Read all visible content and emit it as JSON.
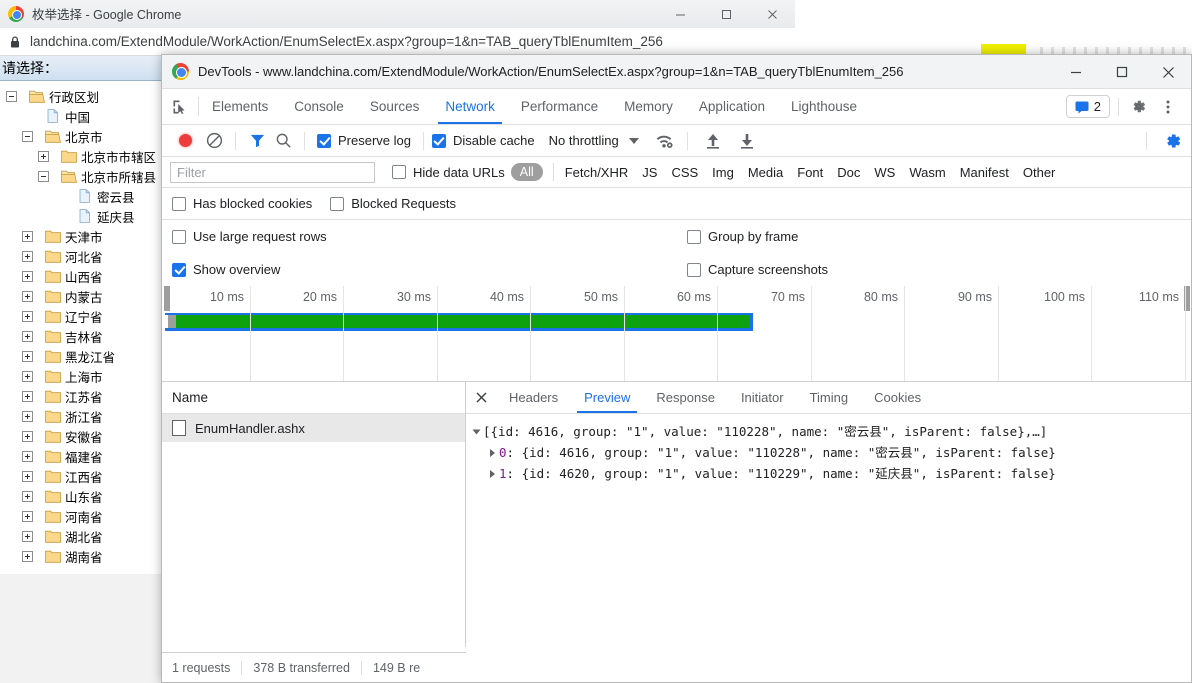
{
  "browser": {
    "window_title": "枚举选择 - Google Chrome",
    "url": "landchina.com/ExtendModule/WorkAction/EnumSelectEx.aspx?group=1&n=TAB_queryTblEnumItem_256",
    "lock_icon": "lock-icon",
    "minimize_label": "Minimize",
    "maximize_label": "Maximize",
    "close_label": "Close"
  },
  "page": {
    "prompt_label": "请选择：",
    "tree": [
      {
        "label": "行政区划",
        "depth": 0,
        "toggle": "minus",
        "icon": "folder-open"
      },
      {
        "label": "中国",
        "depth": 1,
        "toggle": "none",
        "icon": "file"
      },
      {
        "label": "北京市",
        "depth": 1,
        "toggle": "minus",
        "icon": "folder-open"
      },
      {
        "label": "北京市市辖区",
        "depth": 2,
        "toggle": "plus",
        "icon": "folder"
      },
      {
        "label": "北京市所辖县",
        "depth": 2,
        "toggle": "minus",
        "icon": "folder-open"
      },
      {
        "label": "密云县",
        "depth": 3,
        "toggle": "none",
        "icon": "file"
      },
      {
        "label": "延庆县",
        "depth": 3,
        "toggle": "none",
        "icon": "file"
      },
      {
        "label": "天津市",
        "depth": 1,
        "toggle": "plus",
        "icon": "folder"
      },
      {
        "label": "河北省",
        "depth": 1,
        "toggle": "plus",
        "icon": "folder"
      },
      {
        "label": "山西省",
        "depth": 1,
        "toggle": "plus",
        "icon": "folder"
      },
      {
        "label": "内蒙古",
        "depth": 1,
        "toggle": "plus",
        "icon": "folder"
      },
      {
        "label": "辽宁省",
        "depth": 1,
        "toggle": "plus",
        "icon": "folder"
      },
      {
        "label": "吉林省",
        "depth": 1,
        "toggle": "plus",
        "icon": "folder"
      },
      {
        "label": "黑龙江省",
        "depth": 1,
        "toggle": "plus",
        "icon": "folder"
      },
      {
        "label": "上海市",
        "depth": 1,
        "toggle": "plus",
        "icon": "folder"
      },
      {
        "label": "江苏省",
        "depth": 1,
        "toggle": "plus",
        "icon": "folder"
      },
      {
        "label": "浙江省",
        "depth": 1,
        "toggle": "plus",
        "icon": "folder"
      },
      {
        "label": "安徽省",
        "depth": 1,
        "toggle": "plus",
        "icon": "folder"
      },
      {
        "label": "福建省",
        "depth": 1,
        "toggle": "plus",
        "icon": "folder"
      },
      {
        "label": "江西省",
        "depth": 1,
        "toggle": "plus",
        "icon": "folder"
      },
      {
        "label": "山东省",
        "depth": 1,
        "toggle": "plus",
        "icon": "folder"
      },
      {
        "label": "河南省",
        "depth": 1,
        "toggle": "plus",
        "icon": "folder"
      },
      {
        "label": "湖北省",
        "depth": 1,
        "toggle": "plus",
        "icon": "folder"
      },
      {
        "label": "湖南省",
        "depth": 1,
        "toggle": "plus",
        "icon": "folder"
      }
    ]
  },
  "devtools": {
    "window_title": "DevTools - www.landchina.com/ExtendModule/WorkAction/EnumSelectEx.aspx?group=1&n=TAB_queryTblEnumItem_256",
    "inspect_icon": "inspect-element-icon",
    "tabs": [
      {
        "label": "Elements",
        "active": false
      },
      {
        "label": "Console",
        "active": false
      },
      {
        "label": "Sources",
        "active": false
      },
      {
        "label": "Network",
        "active": true
      },
      {
        "label": "Performance",
        "active": false
      },
      {
        "label": "Memory",
        "active": false
      },
      {
        "label": "Application",
        "active": false
      },
      {
        "label": "Lighthouse",
        "active": false
      }
    ],
    "message_count": "2",
    "settings_icon": "gear-icon",
    "more_icon": "more-vertical-icon",
    "accent_color": "#1a73e8",
    "toolbar": {
      "record_icon": "record-stop-icon",
      "clear_icon": "clear-icon",
      "filter_icon": "filter-icon",
      "search_icon": "search-icon",
      "preserve_log_label": "Preserve log",
      "preserve_log_checked": true,
      "disable_cache_label": "Disable cache",
      "disable_cache_checked": true,
      "throttling_label": "No throttling",
      "wifi_icon": "network-conditions-icon",
      "import_icon": "import-har-icon",
      "export_icon": "export-har-icon",
      "net_settings_icon": "gear-icon"
    },
    "filter": {
      "placeholder": "Filter",
      "value": "",
      "hide_data_urls_label": "Hide data URLs",
      "hide_data_urls_checked": false,
      "resource_types": [
        "All",
        "Fetch/XHR",
        "JS",
        "CSS",
        "Img",
        "Media",
        "Font",
        "Doc",
        "WS",
        "Wasm",
        "Manifest",
        "Other"
      ],
      "active_resource_type": "All",
      "has_blocked_cookies_label": "Has blocked cookies",
      "has_blocked_cookies_checked": false,
      "blocked_requests_label": "Blocked Requests",
      "blocked_requests_checked": false
    },
    "options": {
      "large_rows_label": "Use large request rows",
      "large_rows_checked": false,
      "group_by_frame_label": "Group by frame",
      "group_by_frame_checked": false,
      "show_overview_label": "Show overview",
      "show_overview_checked": true,
      "capture_screenshots_label": "Capture screenshots",
      "capture_screenshots_checked": false
    },
    "overview": {
      "ticks": [
        "10 ms",
        "20 ms",
        "30 ms",
        "40 ms",
        "50 ms",
        "60 ms",
        "70 ms",
        "80 ms",
        "90 ms",
        "100 ms",
        "110 ms"
      ],
      "bar_color_wait": "#1a73e8",
      "bar_color_load": "#0ea20e"
    },
    "requests": {
      "name_column": "Name",
      "rows": [
        {
          "name": "EnumHandler.ashx",
          "selected": true
        }
      ]
    },
    "detail": {
      "close_icon": "close-icon",
      "tabs": [
        {
          "label": "Headers",
          "active": false
        },
        {
          "label": "Preview",
          "active": true
        },
        {
          "label": "Response",
          "active": false
        },
        {
          "label": "Initiator",
          "active": false
        },
        {
          "label": "Timing",
          "active": false
        },
        {
          "label": "Cookies",
          "active": false
        }
      ],
      "preview_lines": [
        {
          "expander": "down",
          "indent": 0,
          "text": "[{id: 4616, group: \"1\", value: \"110228\", name: \"密云县\", isParent: false},…]"
        },
        {
          "expander": "right",
          "indent": 1,
          "index": "0",
          "text": ": {id: 4616, group: \"1\", value: \"110228\", name: \"密云县\", isParent: false}"
        },
        {
          "expander": "right",
          "indent": 1,
          "index": "1",
          "text": ": {id: 4620, group: \"1\", value: \"110229\", name: \"延庆县\", isParent: false}"
        }
      ]
    },
    "status": {
      "requests": "1 requests",
      "transferred": "378 B transferred",
      "resources": "149 B re"
    }
  }
}
